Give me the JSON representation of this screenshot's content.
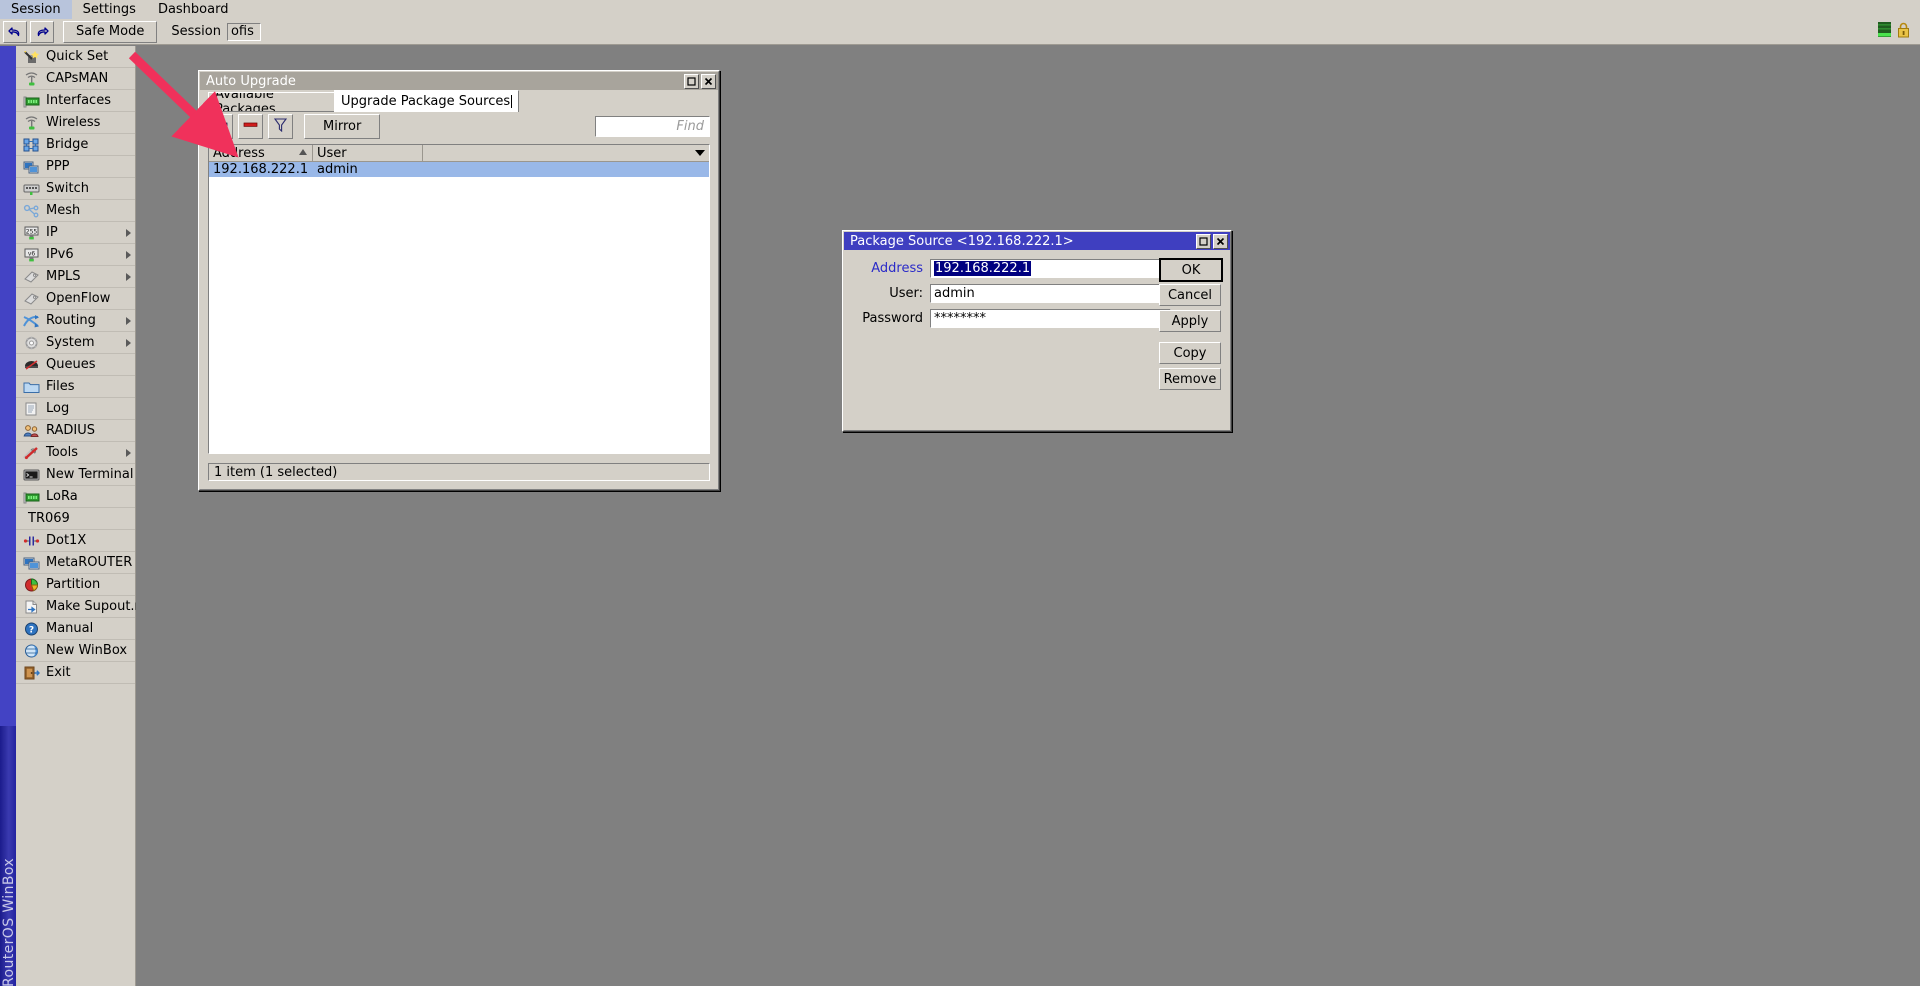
{
  "menubar": {
    "items": [
      "Session",
      "Settings",
      "Dashboard"
    ]
  },
  "toolbar": {
    "undo_icon": "undo-arrow-icon",
    "redo_icon": "redo-arrow-icon",
    "safe_mode_label": "Safe Mode",
    "session_label": "Session",
    "session_value": "ofis",
    "traffic_icon": "traffic-meter-icon",
    "lock_icon": "padlock-icon"
  },
  "sidebar": {
    "banner_text": "RouterOS WinBox",
    "items": [
      {
        "label": "Quick Set",
        "icon": "quick-set-icon",
        "arrow": false
      },
      {
        "label": "CAPsMAN",
        "icon": "capsman-icon",
        "arrow": false
      },
      {
        "label": "Interfaces",
        "icon": "interfaces-icon",
        "arrow": false
      },
      {
        "label": "Wireless",
        "icon": "wireless-icon",
        "arrow": false
      },
      {
        "label": "Bridge",
        "icon": "bridge-icon",
        "arrow": false
      },
      {
        "label": "PPP",
        "icon": "ppp-icon",
        "arrow": false
      },
      {
        "label": "Switch",
        "icon": "switch-icon",
        "arrow": false
      },
      {
        "label": "Mesh",
        "icon": "mesh-icon",
        "arrow": false
      },
      {
        "label": "IP",
        "icon": "ip-icon",
        "arrow": true
      },
      {
        "label": "IPv6",
        "icon": "ipv6-icon",
        "arrow": true
      },
      {
        "label": "MPLS",
        "icon": "mpls-icon",
        "arrow": true
      },
      {
        "label": "OpenFlow",
        "icon": "openflow-icon",
        "arrow": false
      },
      {
        "label": "Routing",
        "icon": "routing-icon",
        "arrow": true
      },
      {
        "label": "System",
        "icon": "system-gear-icon",
        "arrow": true
      },
      {
        "label": "Queues",
        "icon": "queues-icon",
        "arrow": false
      },
      {
        "label": "Files",
        "icon": "files-folder-icon",
        "arrow": false
      },
      {
        "label": "Log",
        "icon": "log-icon",
        "arrow": false
      },
      {
        "label": "RADIUS",
        "icon": "radius-icon",
        "arrow": false
      },
      {
        "label": "Tools",
        "icon": "tools-icon",
        "arrow": true
      },
      {
        "label": "New Terminal",
        "icon": "terminal-icon",
        "arrow": false
      },
      {
        "label": "LoRa",
        "icon": "lora-icon",
        "arrow": false
      },
      {
        "label": "TR069",
        "icon": "",
        "arrow": false
      },
      {
        "label": "Dot1X",
        "icon": "dot1x-icon",
        "arrow": false
      },
      {
        "label": "MetaROUTER",
        "icon": "metarouter-icon",
        "arrow": false
      },
      {
        "label": "Partition",
        "icon": "partition-icon",
        "arrow": false
      },
      {
        "label": "Make Supout.rif",
        "icon": "supout-icon",
        "arrow": false
      },
      {
        "label": "Manual",
        "icon": "manual-help-icon",
        "arrow": false
      },
      {
        "label": "New WinBox",
        "icon": "new-winbox-icon",
        "arrow": false
      },
      {
        "label": "Exit",
        "icon": "exit-door-icon",
        "arrow": false
      }
    ]
  },
  "auto_upgrade": {
    "title": "Auto Upgrade",
    "maximize_icon": "maximize-icon",
    "close_icon": "close-icon",
    "tabs": [
      {
        "label": "Available Packages",
        "active": false
      },
      {
        "label": "Upgrade Package Sources",
        "active": true
      }
    ],
    "toolbar": {
      "add_icon": "plus-add-icon",
      "remove_icon": "minus-remove-icon",
      "filter_icon": "filter-funnel-icon",
      "mirror_label": "Mirror",
      "find_placeholder": "Find",
      "dropdown_icon": "chevron-down-icon"
    },
    "table": {
      "columns": [
        "Address",
        "User",
        ""
      ],
      "sort_column": "Address",
      "rows": [
        {
          "address": "192.168.222.1",
          "user": "admin",
          "selected": true
        }
      ]
    },
    "status": "1 item (1 selected)"
  },
  "package_source": {
    "title": "Package Source <192.168.222.1>",
    "maximize_icon": "maximize-icon",
    "close_icon": "close-icon",
    "fields": [
      {
        "label": "Address",
        "value": "192.168.222.1",
        "selected": true,
        "label_color": "#2b2bc8"
      },
      {
        "label": "User:",
        "value": "admin",
        "selected": false,
        "label_color": "#000000"
      },
      {
        "label": "Password",
        "value": "********",
        "selected": false,
        "label_color": "#000000"
      }
    ],
    "buttons": [
      "OK",
      "Cancel",
      "Apply",
      "Copy",
      "Remove"
    ]
  },
  "annotation": {
    "arrow_color": "#f0315b",
    "points_to": "plus-add-icon"
  },
  "colors": {
    "face": "#d4d0c8",
    "desktop": "#808080",
    "sidebar_strip": "#4343c4",
    "active_title": "#3f3fc0",
    "inactive_title": "#a8a49c",
    "row_select": "#99b8e8",
    "field_select": "#000080"
  }
}
